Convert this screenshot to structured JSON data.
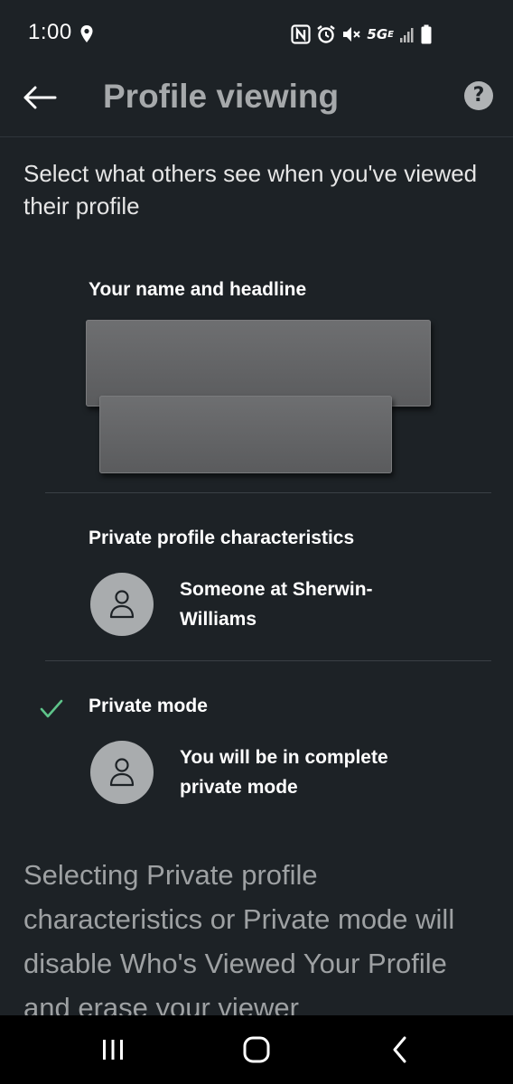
{
  "status_bar": {
    "time": "1:00",
    "network": "5G",
    "network_sub": "E",
    "icons": [
      "location-icon",
      "nfc-icon",
      "alarm-icon",
      "mute-icon",
      "signal-icon",
      "battery-icon"
    ]
  },
  "header": {
    "title": "Profile viewing",
    "back_icon": "back-arrow-icon",
    "help_icon": "?"
  },
  "intro": "Select what others see when you've viewed their profile",
  "options": [
    {
      "title": "Your name and headline",
      "selected": false
    },
    {
      "title": "Private profile characteristics",
      "description": "Someone at Sherwin-Williams",
      "selected": false
    },
    {
      "title": "Private mode",
      "description": "You will be in complete private mode",
      "selected": true
    }
  ],
  "disclaimer": "Selecting Private profile characteristics or Private mode will disable Who's Viewed Your Profile and erase your viewer",
  "colors": {
    "background": "#1d2226",
    "check": "#5ec48a",
    "avatar": "#a9acae",
    "title": "#a6a9ab"
  },
  "nav": {
    "icons": [
      "recents-icon",
      "home-icon",
      "back-icon"
    ]
  }
}
